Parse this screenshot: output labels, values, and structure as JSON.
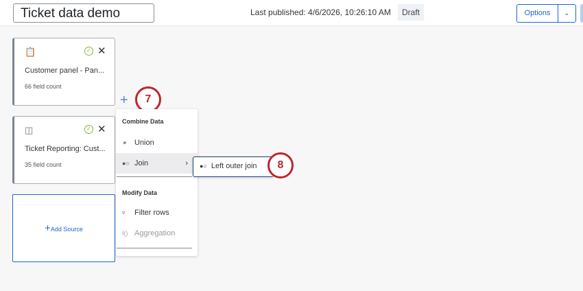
{
  "header": {
    "title": "Ticket data demo",
    "last_published": "Last published: 4/6/2026, 10:26:10 AM",
    "status": "Draft",
    "options_label": "Options"
  },
  "cards": [
    {
      "name": "Customer panel - Pan...",
      "field_count": "66 field count",
      "icon": "clipboard-icon"
    },
    {
      "name": "Ticket Reporting: Cust...",
      "field_count": "35 field count",
      "icon": "ticket-icon"
    }
  ],
  "add_source": "Add Source",
  "menu": {
    "combine_header": "Combine Data",
    "union": "Union",
    "join": "Join",
    "modify_header": "Modify Data",
    "filter": "Filter rows",
    "aggregation": "Aggregation"
  },
  "submenu": {
    "left_outer_join": "Left outer join"
  },
  "badges": [
    "7",
    "8"
  ]
}
